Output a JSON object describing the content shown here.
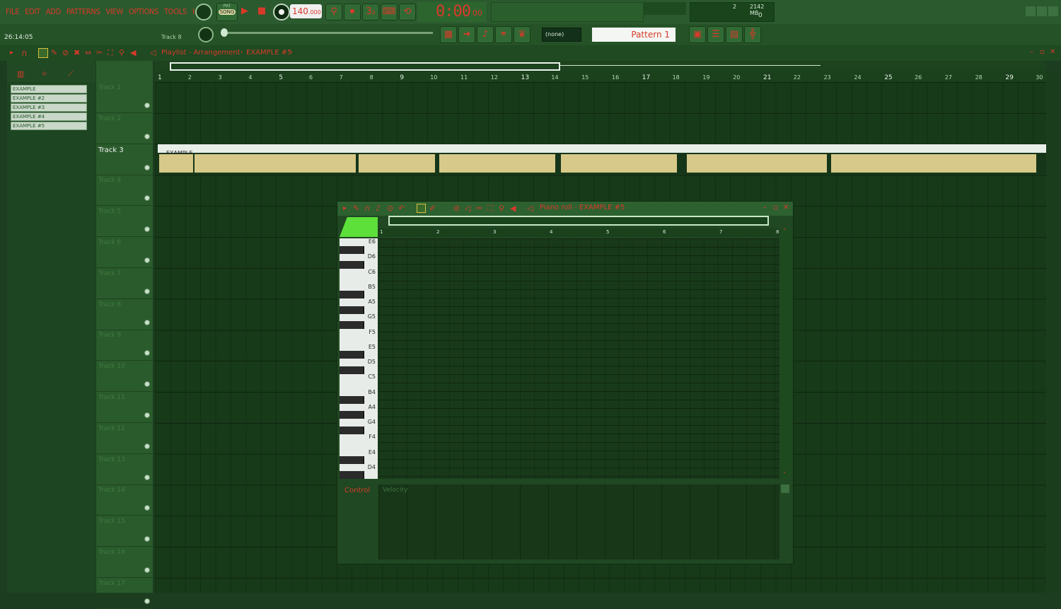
{
  "menu": [
    "FILE",
    "EDIT",
    "ADD",
    "PATTERNS",
    "VIEW",
    "OPTIONS",
    "TOOLS",
    "HELP"
  ],
  "transport": {
    "pat_label": "PAT",
    "song_label": "SONG",
    "tempo": "140",
    "tempo_frac": ".000",
    "time": "0:00",
    "time_frac": "00",
    "cpu_value": "2",
    "memory": "2142 MB",
    "poly_value": "0"
  },
  "hint": {
    "time": "26:14:05",
    "track": "Track 8"
  },
  "toolbar": {
    "channel_none": "(none)",
    "pattern": "Pattern 1"
  },
  "playlist": {
    "breadcrumb_1": "Playlist - Arrangement",
    "breadcrumb_2": "EXAMPLE #5",
    "patterns": [
      "EXAMPLE",
      "EXAMPLE #2",
      "EXAMPLE #3",
      "EXAMPLE #4",
      "EXAMPLE #5"
    ],
    "ruler": [
      "1",
      "2",
      "3",
      "4",
      "5",
      "6",
      "7",
      "8",
      "9",
      "10",
      "11",
      "12",
      "13",
      "14",
      "15",
      "16",
      "17",
      "18",
      "19",
      "20",
      "21",
      "22",
      "23",
      "24",
      "25",
      "26",
      "27",
      "28",
      "29",
      "30"
    ],
    "tracks": [
      "Track 1",
      "Track 2",
      "Track 3",
      "Track 4",
      "Track 5",
      "Track 6",
      "Track 7",
      "Track 8",
      "Track 9",
      "Track 10",
      "Track 11",
      "Track 12",
      "Track 13",
      "Track 14",
      "Track 15",
      "Track 16",
      "Track 17"
    ],
    "clip_label": "EXAMPLE"
  },
  "piano_roll": {
    "title": "Piano roll - EXAMPLE #5",
    "ruler": [
      "1",
      "2",
      "3",
      "4",
      "5",
      "6",
      "7",
      "8"
    ],
    "keys": [
      "E6",
      "D6",
      "C6",
      "B5",
      "A5",
      "G5",
      "F5",
      "E5",
      "D5",
      "C5",
      "B4",
      "A4",
      "G4",
      "F4",
      "E4",
      "D4"
    ],
    "control_label": "Control",
    "velocity_label": "Velocity"
  },
  "colors": {
    "accent": "#d83a2a",
    "background": "#1c3d1f",
    "highlight_green": "#5de03a",
    "waveform": "#d7c989"
  }
}
